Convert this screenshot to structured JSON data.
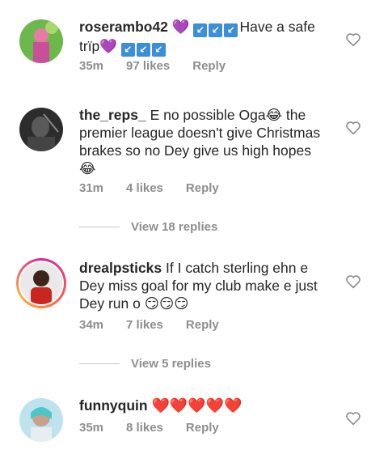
{
  "comments": [
    {
      "username": "roserambo42",
      "text_pre": "💜 ",
      "checks_1": [
        "↙",
        "↙",
        "↙"
      ],
      "text_main": "Have a safe",
      "text_line2": "trïp💜 ",
      "checks_2": [
        "↙",
        "↙",
        "↙"
      ],
      "time": "35m",
      "likes": "97 likes",
      "reply": "Reply"
    },
    {
      "username": "the_reps_",
      "text": "E no possible Oga😂 the premier league doesn't give Christmas brakes so no Dey give us high hopes 😂",
      "time": "31m",
      "likes": "4 likes",
      "reply": "Reply",
      "view_replies": "View 18 replies"
    },
    {
      "username": "drealpsticks",
      "text": "If I catch sterling ehn e Dey miss goal for my club make e just Dey run o 😏😏😏",
      "time": "34m",
      "likes": "7 likes",
      "reply": "Reply",
      "view_replies": "View 5 replies"
    },
    {
      "username": "funnyquin",
      "text": "❤️❤️❤️❤️❤️",
      "time": "35m",
      "likes": "8 likes",
      "reply": "Reply"
    }
  ],
  "colors": {
    "meta": "#8e8e8e",
    "text": "#262626",
    "check_blue": "#3b8fd9"
  }
}
